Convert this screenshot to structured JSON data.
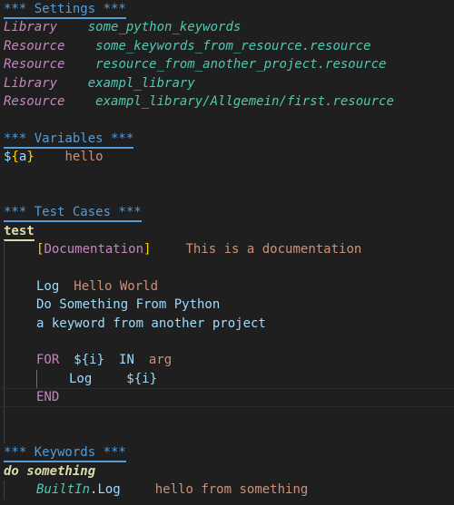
{
  "settings": {
    "header": "*** Settings ***",
    "rows": [
      {
        "setting": "Library",
        "gap": "    ",
        "value": "some_python_keywords"
      },
      {
        "setting": "Resource",
        "gap": "    ",
        "value": "some_keywords_from_resource.resource"
      },
      {
        "setting": "Resource",
        "gap": "    ",
        "value": "resource_from_another_project.resource"
      },
      {
        "setting": "Library",
        "gap": "    ",
        "value": "exampl_library"
      },
      {
        "setting": "Resource",
        "gap": "    ",
        "value": "exampl_library/Allgemein/first.resource"
      }
    ]
  },
  "variables": {
    "header": "*** Variables ***",
    "rows": [
      {
        "sigil": "$",
        "open": "{",
        "name": "a",
        "close": "}",
        "gap": "    ",
        "value": "hello"
      }
    ]
  },
  "test_cases": {
    "header": "*** Test Cases ***",
    "name": "test",
    "documentation": {
      "open": "[",
      "setting": "Documentation",
      "close": "]",
      "value": "This is a documentation"
    },
    "steps": [
      {
        "keyword": "Log",
        "arg": "Hello World"
      },
      {
        "keyword": "Do Something From Python"
      },
      {
        "keyword": "a keyword from another project"
      }
    ],
    "for_loop": {
      "for": "FOR",
      "var": {
        "sigil": "$",
        "open": "{",
        "name": "i",
        "close": "}"
      },
      "in": "IN",
      "arg": "arg",
      "body_keyword": "Log",
      "body_var": {
        "sigil": "$",
        "open": "{",
        "name": "i",
        "close": "}"
      },
      "end": "END"
    }
  },
  "keywords": {
    "header": "*** Keywords ***",
    "name": "do something",
    "step": {
      "library": "BuiltIn",
      "dot": ".",
      "keyword": "Log",
      "arg": "hello from something"
    }
  }
}
